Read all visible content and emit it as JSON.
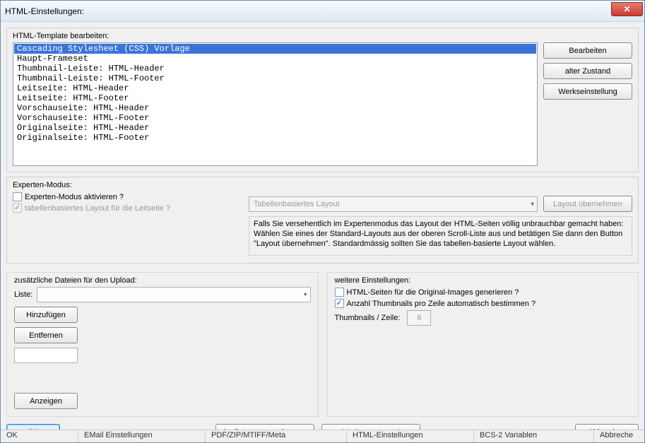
{
  "window": {
    "title": "HTML-Einstellungen:"
  },
  "template": {
    "groupLabel": "HTML-Template bearbeiten:",
    "items": [
      "Cascading Stylesheet (CSS) Vorlage",
      "Haupt-Frameset",
      "Thumbnail-Leiste: HTML-Header",
      "Thumbnail-Leiste: HTML-Footer",
      "Leitseite: HTML-Header",
      "Leitseite: HTML-Footer",
      "Vorschauseite: HTML-Header",
      "Vorschauseite: HTML-Footer",
      "Originalseite: HTML-Header",
      "Originalseite: HTML-Footer"
    ],
    "buttons": {
      "edit": "Bearbeiten",
      "revert": "alter Zustand",
      "factory": "Werkseinstellung"
    }
  },
  "expert": {
    "groupLabel": "Experten-Modus:",
    "activate": "Experten-Modus aktivieren ?",
    "tableLayoutLeit": "tabellenbasiertes Layout für die Leitseite ?",
    "layoutCombo": "Tabellenbasiertes Layout",
    "applyLayout": "Layout übernehmen",
    "description": "Falls Sie versehentlich im Expertenmodus das Layout der HTML-Seiten völlig unbrauchbar gemacht haben: Wählen Sie eines der Standard-Layouts aus der oberen Scroll-Liste aus und betätigen Sie dann den Button \"Layout übernehmen\". Standardmässig sollten Sie das tabellen-basierte Layout wählen."
  },
  "upload": {
    "groupLabel": "zusätzliche Dateien für den Upload:",
    "liste": "Liste:",
    "add": "Hinzufügen",
    "remove": "Entfernen",
    "show": "Anzeigen"
  },
  "settings": {
    "groupLabel": "weitere Einstellungen:",
    "genOriginal": "HTML-Seiten für die Original-Images generieren ?",
    "autoThumbs": "Anzahl Thumbnails pro Zeile automatisch bestimmen ?",
    "thumbsLabel": "Thumbnails / Zeile:",
    "thumbsValue": "6"
  },
  "bottom": {
    "ok": "OK",
    "browser": "im Browser anzeigen ...",
    "apply": "auf Auftrag anwenden",
    "cancel": "Abbrechen"
  },
  "statusbar": {
    "c0": "OK",
    "c1": "EMail Einstellungen",
    "c2": "PDF/ZIP/MTIFF/Meta",
    "c3": "HTML-Einstellungen",
    "c4": "BCS-2 Variablen",
    "c5": "Abbreche"
  }
}
